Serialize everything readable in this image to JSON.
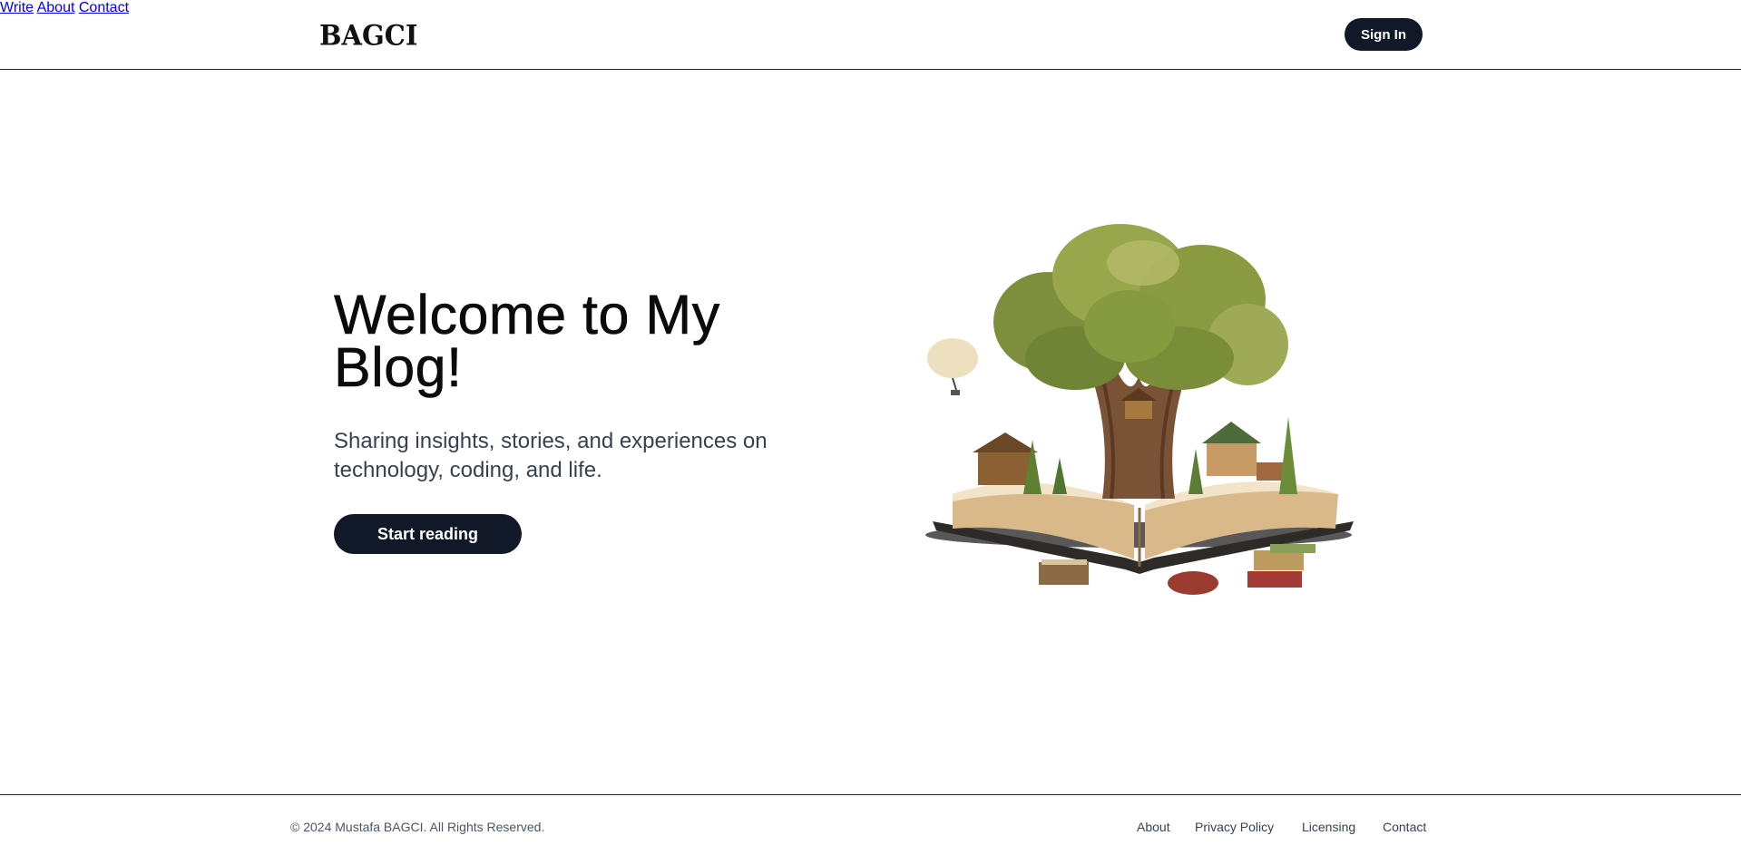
{
  "header": {
    "logo": "BAGCI",
    "nav": [
      "Write",
      "About",
      "Contact"
    ],
    "signin_label": "Sign In"
  },
  "hero": {
    "title": "Welcome to My Blog!",
    "subtitle": "Sharing insights, stories, and experiences on technology, coding, and life.",
    "cta_label": "Start reading",
    "illustration": "open-book-tree-illustration"
  },
  "footer": {
    "copyright": "© 2024 Mustafa BAGCI. All Rights Reserved.",
    "links": [
      "About",
      "Privacy Policy",
      "Licensing",
      "Contact"
    ]
  },
  "colors": {
    "primary_dark": "#111827",
    "text": "#111111",
    "muted": "#374151",
    "border": "#1f2937"
  }
}
